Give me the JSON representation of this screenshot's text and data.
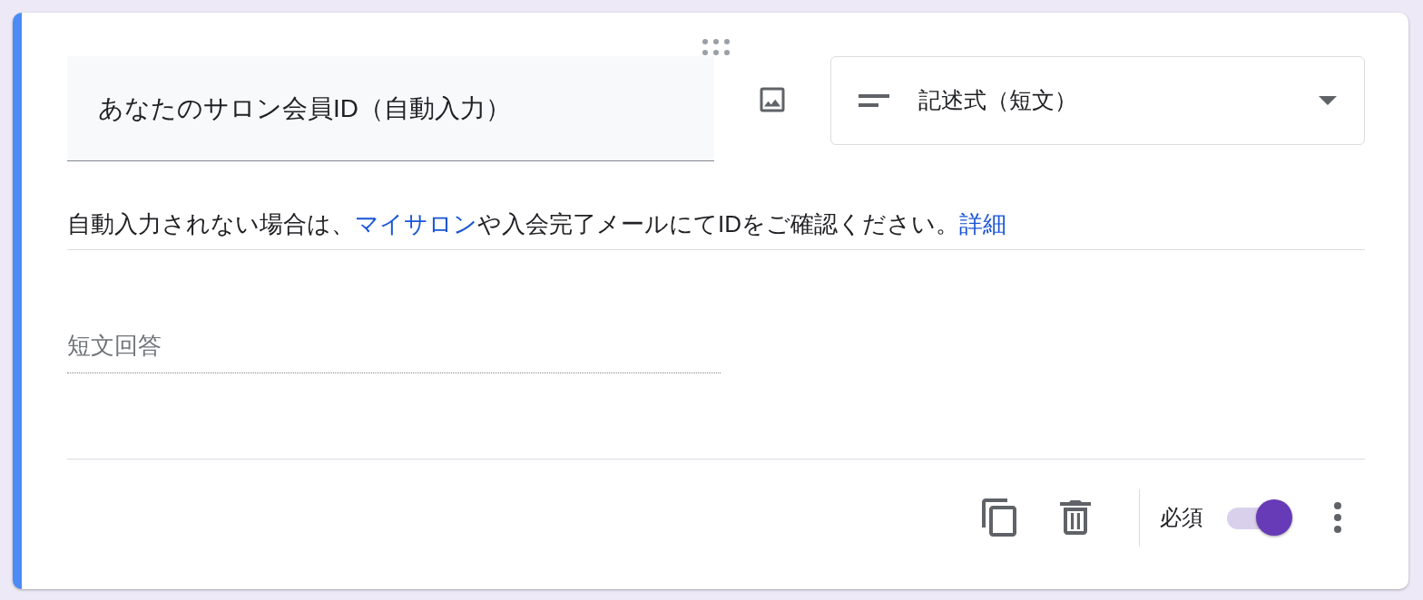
{
  "question": {
    "active": true,
    "title": "あなたのサロン会員ID（自動入力）",
    "type_dropdown": {
      "label": "記述式（短文）"
    },
    "description": [
      {
        "kind": "text",
        "text": "自動入力されない場合は、"
      },
      {
        "kind": "link",
        "text": "マイサロン"
      },
      {
        "kind": "text",
        "text": "や入会完了メールにてIDをご確認ください。"
      },
      {
        "kind": "link",
        "text": "詳細"
      }
    ],
    "answer": {
      "placeholder": "短文回答"
    }
  },
  "footer": {
    "required_label": "必須",
    "required": {
      "on": true
    }
  }
}
